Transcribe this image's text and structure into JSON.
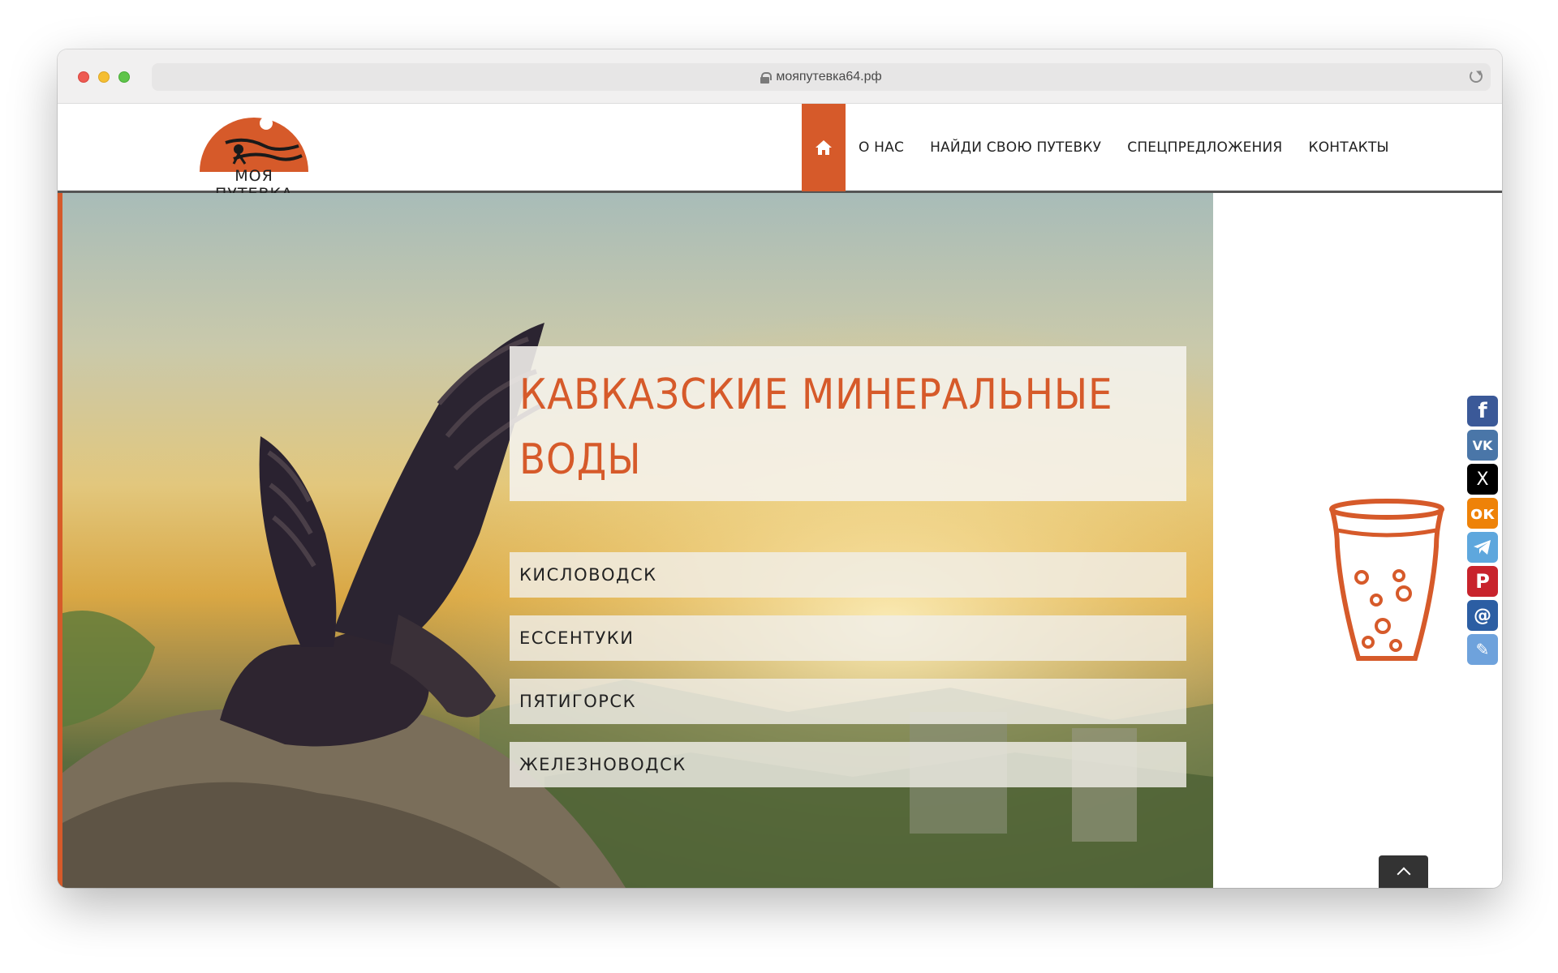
{
  "browser": {
    "url": "мояпутевка64.рф"
  },
  "logo": {
    "text": "МОЯ ПУТЕВКА"
  },
  "nav": {
    "home_icon": "home-icon",
    "items": [
      {
        "label": "О НАС"
      },
      {
        "label": "НАЙДИ СВОЮ ПУТЕВКУ"
      },
      {
        "label": "СПЕЦПРЕДЛОЖЕНИЯ"
      },
      {
        "label": "КОНТАКТЫ"
      }
    ]
  },
  "hero": {
    "title_line1": "КАВКАЗСКИЕ МИНЕРАЛЬНЫЕ",
    "title_line2": "ВОДЫ",
    "cities": [
      {
        "label": "КИСЛОВОДСК"
      },
      {
        "label": "ЕССЕНТУКИ"
      },
      {
        "label": "ПЯТИГОРСК"
      },
      {
        "label": "ЖЕЛЕЗНОВОДСК"
      }
    ]
  },
  "social": {
    "items": [
      {
        "icon": "facebook-icon",
        "glyph": "f"
      },
      {
        "icon": "vk-icon",
        "glyph": "VK"
      },
      {
        "icon": "x-icon",
        "glyph": "X"
      },
      {
        "icon": "odnoklassniki-icon",
        "glyph": "ок"
      },
      {
        "icon": "telegram-icon",
        "glyph": ""
      },
      {
        "icon": "pinterest-icon",
        "glyph": "P"
      },
      {
        "icon": "mail-icon",
        "glyph": "@"
      },
      {
        "icon": "livejournal-icon",
        "glyph": "✎"
      }
    ]
  },
  "colors": {
    "accent": "#d65a2a",
    "header_border": "#555555"
  }
}
